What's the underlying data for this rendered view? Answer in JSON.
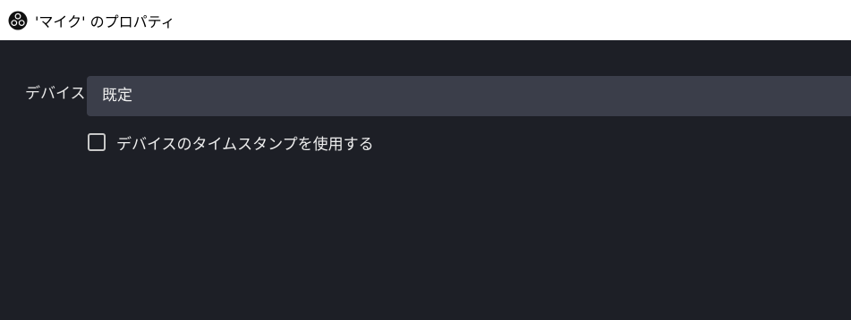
{
  "window": {
    "title": "'マイク' のプロパティ",
    "icon": "obs-logo-icon"
  },
  "form": {
    "device_label": "デバイス",
    "device_value": "既定",
    "timestamp_checkbox": {
      "label": "デバイスのタイムスタンプを使用する",
      "checked": false
    }
  },
  "colors": {
    "titlebar": "#ffffff",
    "background": "#1d1f26",
    "select_bg": "#3b3e4a",
    "text": "#e6e6e6"
  }
}
